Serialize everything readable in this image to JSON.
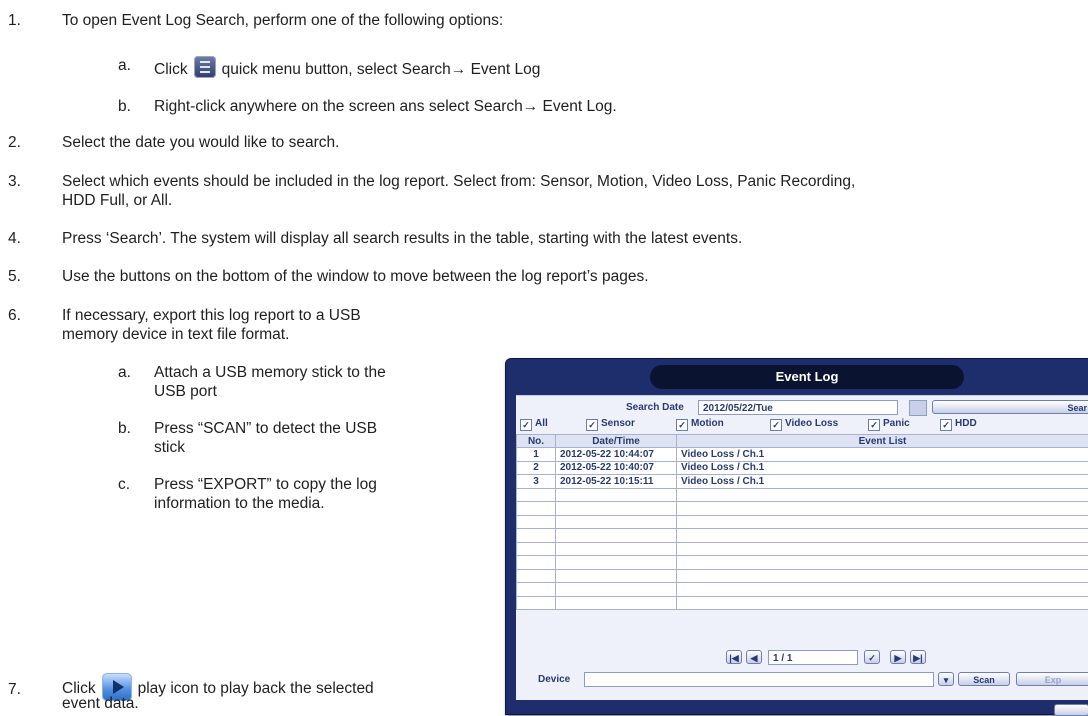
{
  "steps": {
    "s1": {
      "num": "1.",
      "text": "To open Event Log Search, perform one of the following options:"
    },
    "s1a": {
      "letter": "a.",
      "before": "Click",
      "icon": "quick-menu-icon",
      "after": "quick menu button, select Search→ Event Log"
    },
    "s1b": {
      "letter": "b.",
      "text": "Right-click anywhere on the screen ans select Search→ Event Log."
    },
    "s2": {
      "num": "2.",
      "text": "Select the date you would like to search."
    },
    "s3": {
      "num": "3.",
      "text": "Select which events should be included in the log report. Select from: Sensor, Motion, Video Loss, Panic Recording,",
      "text2": "HDD Full, or All."
    },
    "s4": {
      "num": "4.",
      "text": "Press ‘Search’. The system will display all search results in the table, starting with the latest events."
    },
    "s5": {
      "num": "5.",
      "text": "Use the buttons on the bottom of the window to move between the log report’s pages."
    },
    "s6": {
      "num": "6.",
      "text": "If necessary, export this log report to a USB",
      "text2": "memory device in text file format."
    },
    "s6a": {
      "letter": "a.",
      "text": "Attach a USB memory stick to the",
      "text2": "USB port"
    },
    "s6b": {
      "letter": "b.",
      "text": "Press “SCAN” to detect the USB",
      "text2": "stick"
    },
    "s6c": {
      "letter": "c.",
      "text": "Press “EXPORT” to copy the log",
      "text2": "information to the media."
    },
    "s7": {
      "num": "7.",
      "before": "Click",
      "icon": "play-icon",
      "after": "play icon to play back the selected",
      "text2": "event data."
    }
  },
  "event_log": {
    "title": "Event Log",
    "search_date_label": "Search Date",
    "search_date_value": "2012/05/22/Tue",
    "search_button": "Sear",
    "filters": [
      "All",
      "Sensor",
      "Motion",
      "Video Loss",
      "Panic",
      "HDD"
    ],
    "columns": [
      "No.",
      "Date/Time",
      "Event List"
    ],
    "rows": [
      {
        "no": "1",
        "datetime": "2012-05-22 10:44:07",
        "event": "Video Loss  / Ch.1"
      },
      {
        "no": "2",
        "datetime": "2012-05-22 10:40:07",
        "event": "Video Loss  / Ch.1"
      },
      {
        "no": "3",
        "datetime": "2012-05-22 10:15:11",
        "event": "Video Loss  / Ch.1"
      }
    ],
    "page": "1 / 1",
    "device_label": "Device",
    "scan_button": "Scan",
    "export_button": "Exp"
  }
}
